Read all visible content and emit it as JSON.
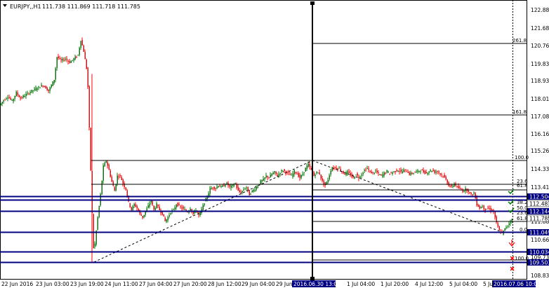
{
  "colors": {
    "bull": "#008000",
    "bear": "#ff0000",
    "hline": "#000080",
    "fib": "#000000",
    "bg": "#ffffff"
  },
  "header": {
    "symbol_tf": "EURJPY,,H1",
    "ohlc": "111.738 111.869 111.718 111.785",
    "menu_icon": "triangle-down-icon"
  },
  "price_axis": {
    "labels": [
      "122.885",
      "121.685",
      "120.760",
      "119.835",
      "118.935",
      "118.010",
      "117.085",
      "116.160",
      "115.260",
      "114.335",
      "113.410",
      "111.885",
      "110.660",
      "109.735",
      "108.835"
    ],
    "badges": [
      {
        "label": "112.504",
        "color": "#000080"
      },
      {
        "label": "112.487",
        "color": "#ffffff"
      },
      {
        "label": "112.144",
        "color": "#000080"
      },
      {
        "label": "111.785",
        "color": "#ffffff"
      },
      {
        "label": "111.049",
        "color": "#000080"
      },
      {
        "label": "110.034",
        "color": "#000080"
      },
      {
        "label": "109.503",
        "color": "#000080"
      }
    ]
  },
  "time_axis": {
    "labels": [
      "22 Jun 2016",
      "23 Jun 03:00",
      "23 Jun 19:00",
      "24 Jun 11:00",
      "27 Jun 04:00",
      "27 Jun 20:00",
      "28 Jun 12:00",
      "29 Jun 04:00",
      "29 Jun",
      "1 Jul 04:00",
      "1 Jul 20:00",
      "4 Jul 12:00",
      "5 Jul 04:00",
      "5 Jul"
    ],
    "crosshair_badge": "2016.06.30 13:00",
    "badge_right": "2016.07.06 10:00"
  },
  "fibonacci": {
    "levels": [
      "261.8",
      "161.8",
      "100.0",
      "23.6",
      "61.8",
      "38.2",
      "50.0",
      "23.6",
      "61.8",
      "0.0",
      "100.0"
    ]
  },
  "chart_data": [
    {
      "type": "candlestick",
      "symbol": "EURJPY",
      "timeframe": "H1",
      "last_ohlc": {
        "open": 111.738,
        "high": 111.869,
        "low": 111.718,
        "close": 111.785
      },
      "horizontal_levels": [
        112.504,
        112.144,
        111.049,
        110.034,
        109.503
      ],
      "price_path": [
        [
          0,
          117.85
        ],
        [
          6,
          118.1
        ],
        [
          12,
          118.3
        ],
        [
          18,
          118.05
        ],
        [
          24,
          118.5
        ],
        [
          30,
          118.2
        ],
        [
          38,
          118.4
        ],
        [
          46,
          118.6
        ],
        [
          54,
          118.75
        ],
        [
          62,
          118.9
        ],
        [
          70,
          118.6
        ],
        [
          78,
          119.2
        ],
        [
          82,
          120.4
        ],
        [
          88,
          120.2
        ],
        [
          94,
          120.3
        ],
        [
          100,
          120.1
        ],
        [
          106,
          120.3
        ],
        [
          112,
          120.5
        ],
        [
          116,
          121.3
        ],
        [
          120,
          120.7
        ],
        [
          124,
          119.8
        ],
        [
          126,
          118.8
        ],
        [
          128,
          116.6
        ],
        [
          130,
          114.4
        ],
        [
          132,
          112.1
        ],
        [
          134,
          110.3
        ],
        [
          136,
          110.5
        ],
        [
          140,
          111.9
        ],
        [
          144,
          113.1
        ],
        [
          148,
          114.6
        ],
        [
          152,
          114.9
        ],
        [
          156,
          114.4
        ],
        [
          160,
          113.8
        ],
        [
          164,
          113.3
        ],
        [
          168,
          114.1
        ],
        [
          172,
          114.1
        ],
        [
          176,
          113.7
        ],
        [
          180,
          113.4
        ],
        [
          184,
          112.7
        ],
        [
          188,
          112.3
        ],
        [
          192,
          112.6
        ],
        [
          196,
          112.4
        ],
        [
          200,
          112.1
        ],
        [
          204,
          111.9
        ],
        [
          208,
          112.2
        ],
        [
          212,
          112.5
        ],
        [
          216,
          112.8
        ],
        [
          220,
          112.3
        ],
        [
          224,
          112.6
        ],
        [
          228,
          112.3
        ],
        [
          232,
          112.1
        ],
        [
          236,
          111.7
        ],
        [
          240,
          111.9
        ],
        [
          244,
          112.2
        ],
        [
          248,
          112.3
        ],
        [
          252,
          112.6
        ],
        [
          256,
          112.5
        ],
        [
          260,
          112.4
        ],
        [
          264,
          112.3
        ],
        [
          268,
          112.2
        ],
        [
          272,
          112.4
        ],
        [
          276,
          112.1
        ],
        [
          280,
          112.3
        ],
        [
          284,
          112.0
        ],
        [
          288,
          112.3
        ],
        [
          292,
          112.7
        ],
        [
          296,
          113.0
        ],
        [
          300,
          113.4
        ],
        [
          304,
          113.5
        ],
        [
          308,
          113.45
        ],
        [
          312,
          113.6
        ],
        [
          316,
          113.5
        ],
        [
          320,
          113.6
        ],
        [
          324,
          113.7
        ],
        [
          328,
          113.5
        ],
        [
          332,
          113.6
        ],
        [
          336,
          113.7
        ],
        [
          340,
          113.3
        ],
        [
          344,
          113.2
        ],
        [
          348,
          113.4
        ],
        [
          352,
          113.5
        ],
        [
          356,
          113.1
        ],
        [
          360,
          113.3
        ],
        [
          364,
          113.4
        ],
        [
          368,
          113.6
        ],
        [
          372,
          113.8
        ],
        [
          376,
          113.9
        ],
        [
          380,
          114.1
        ],
        [
          384,
          114.0
        ],
        [
          388,
          114.2
        ],
        [
          392,
          114.3
        ],
        [
          396,
          114.1
        ],
        [
          400,
          114.3
        ],
        [
          404,
          114.4
        ],
        [
          408,
          114.3
        ],
        [
          412,
          114.2
        ],
        [
          416,
          114.1
        ],
        [
          420,
          114.35
        ],
        [
          424,
          114.2
        ],
        [
          428,
          114.0
        ],
        [
          432,
          114.2
        ],
        [
          436,
          114.5
        ],
        [
          440,
          114.7
        ],
        [
          444,
          114.4
        ],
        [
          448,
          114.1
        ],
        [
          452,
          114.3
        ],
        [
          456,
          114.2
        ],
        [
          460,
          113.8
        ],
        [
          464,
          113.6
        ],
        [
          468,
          113.9
        ],
        [
          472,
          114.4
        ],
        [
          476,
          114.55
        ],
        [
          480,
          114.5
        ],
        [
          484,
          114.5
        ],
        [
          488,
          114.3
        ],
        [
          492,
          114.2
        ],
        [
          496,
          114.3
        ],
        [
          500,
          114.15
        ],
        [
          504,
          114.0
        ],
        [
          508,
          114.2
        ],
        [
          512,
          114.0
        ],
        [
          516,
          114.2
        ],
        [
          520,
          114.4
        ],
        [
          524,
          114.5
        ],
        [
          528,
          114.3
        ],
        [
          532,
          114.25
        ],
        [
          536,
          114.35
        ],
        [
          540,
          114.2
        ],
        [
          544,
          114.1
        ],
        [
          548,
          114.25
        ],
        [
          552,
          114.35
        ],
        [
          556,
          114.2
        ],
        [
          560,
          114.3
        ],
        [
          564,
          114.35
        ],
        [
          568,
          114.4
        ],
        [
          572,
          114.3
        ],
        [
          576,
          114.4
        ],
        [
          580,
          114.35
        ],
        [
          584,
          114.2
        ],
        [
          588,
          114.25
        ],
        [
          592,
          114.3
        ],
        [
          596,
          114.35
        ],
        [
          600,
          114.4
        ],
        [
          604,
          114.3
        ],
        [
          608,
          114.25
        ],
        [
          612,
          114.35
        ],
        [
          616,
          114.4
        ],
        [
          620,
          114.3
        ],
        [
          624,
          114.35
        ],
        [
          628,
          114.2
        ],
        [
          632,
          114.1
        ],
        [
          636,
          113.9
        ],
        [
          640,
          113.6
        ],
        [
          644,
          113.5
        ],
        [
          648,
          113.7
        ],
        [
          652,
          113.5
        ],
        [
          656,
          113.4
        ],
        [
          660,
          113.3
        ],
        [
          664,
          113.4
        ],
        [
          668,
          113.3
        ],
        [
          672,
          113.1
        ],
        [
          676,
          113.2
        ],
        [
          680,
          112.6
        ],
        [
          684,
          112.4
        ],
        [
          688,
          112.5
        ],
        [
          692,
          112.3
        ],
        [
          696,
          112.4
        ],
        [
          700,
          112.3
        ],
        [
          704,
          112.2
        ],
        [
          708,
          111.6
        ],
        [
          712,
          111.2
        ],
        [
          716,
          111.05
        ],
        [
          720,
          111.3
        ],
        [
          724,
          111.5
        ],
        [
          728,
          111.7
        ],
        [
          730,
          111.785
        ]
      ]
    }
  ]
}
